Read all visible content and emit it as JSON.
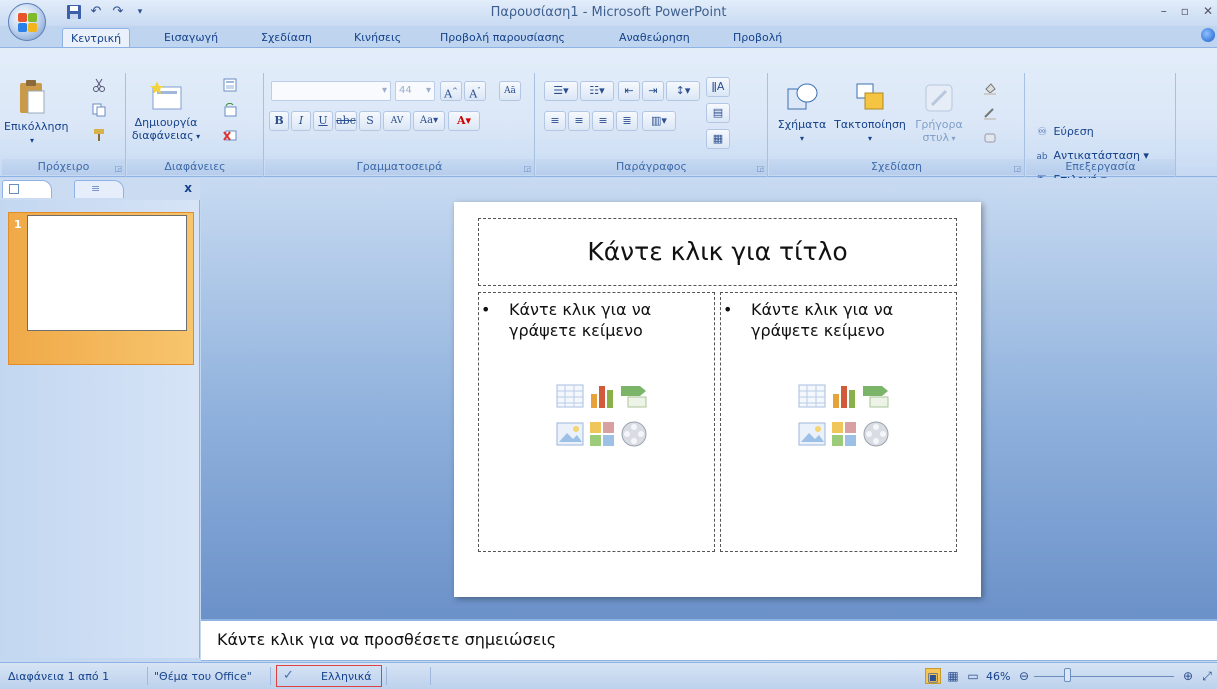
{
  "window": {
    "title": "Παρουσίαση1 - Microsoft PowerPoint",
    "controls": [
      "minimize",
      "restore",
      "close"
    ]
  },
  "quick_access": {
    "icons": [
      "save-icon",
      "undo-icon",
      "redo-icon",
      "customize-icon"
    ]
  },
  "tabs": [
    {
      "label": "Κεντρική",
      "active": true
    },
    {
      "label": "Εισαγωγή"
    },
    {
      "label": "Σχεδίαση"
    },
    {
      "label": "Κινήσεις"
    },
    {
      "label": "Προβολή παρουσίασης"
    },
    {
      "label": "Αναθεώρηση"
    },
    {
      "label": "Προβολή"
    }
  ],
  "ribbon": {
    "clipboard": {
      "label": "Πρόχειρο",
      "paste": "Επικόλληση"
    },
    "slides": {
      "label": "Διαφάνειες",
      "new_slide_line1": "Δημιουργία",
      "new_slide_line2": "διαφάνειας"
    },
    "font": {
      "label": "Γραμματοσειρά",
      "font_name": "",
      "font_size": "44"
    },
    "paragraph": {
      "label": "Παράγραφος"
    },
    "drawing": {
      "label": "Σχεδίαση",
      "shapes": "Σχήματα",
      "arrange": "Τακτοποίηση",
      "quick_styles_line1": "Γρήγορα",
      "quick_styles_line2": "στυλ"
    },
    "editing": {
      "label": "Επεξεργασία",
      "find": "Εύρεση",
      "replace": "Αντικατάσταση",
      "select": "Επιλογή"
    }
  },
  "slide_pane": {
    "slide_number": "1"
  },
  "slide": {
    "title_placeholder": "Κάντε κλικ για τίτλο",
    "content_left": "Κάντε κλικ για να γράψετε κείμενο",
    "content_right": "Κάντε κλικ για να γράψετε κείμενο"
  },
  "notes": {
    "placeholder": "Κάντε κλικ για να προσθέσετε σημειώσεις"
  },
  "status": {
    "slide_info": "Διαφάνεια 1 από 1",
    "theme": "\"Θέμα του Office\"",
    "language": "Ελληνικά",
    "zoom": "46%"
  },
  "colors": {
    "accent": "#15428b",
    "ribbon_bg": "#dbe7f7",
    "selected_thumb": "#f0a948"
  }
}
